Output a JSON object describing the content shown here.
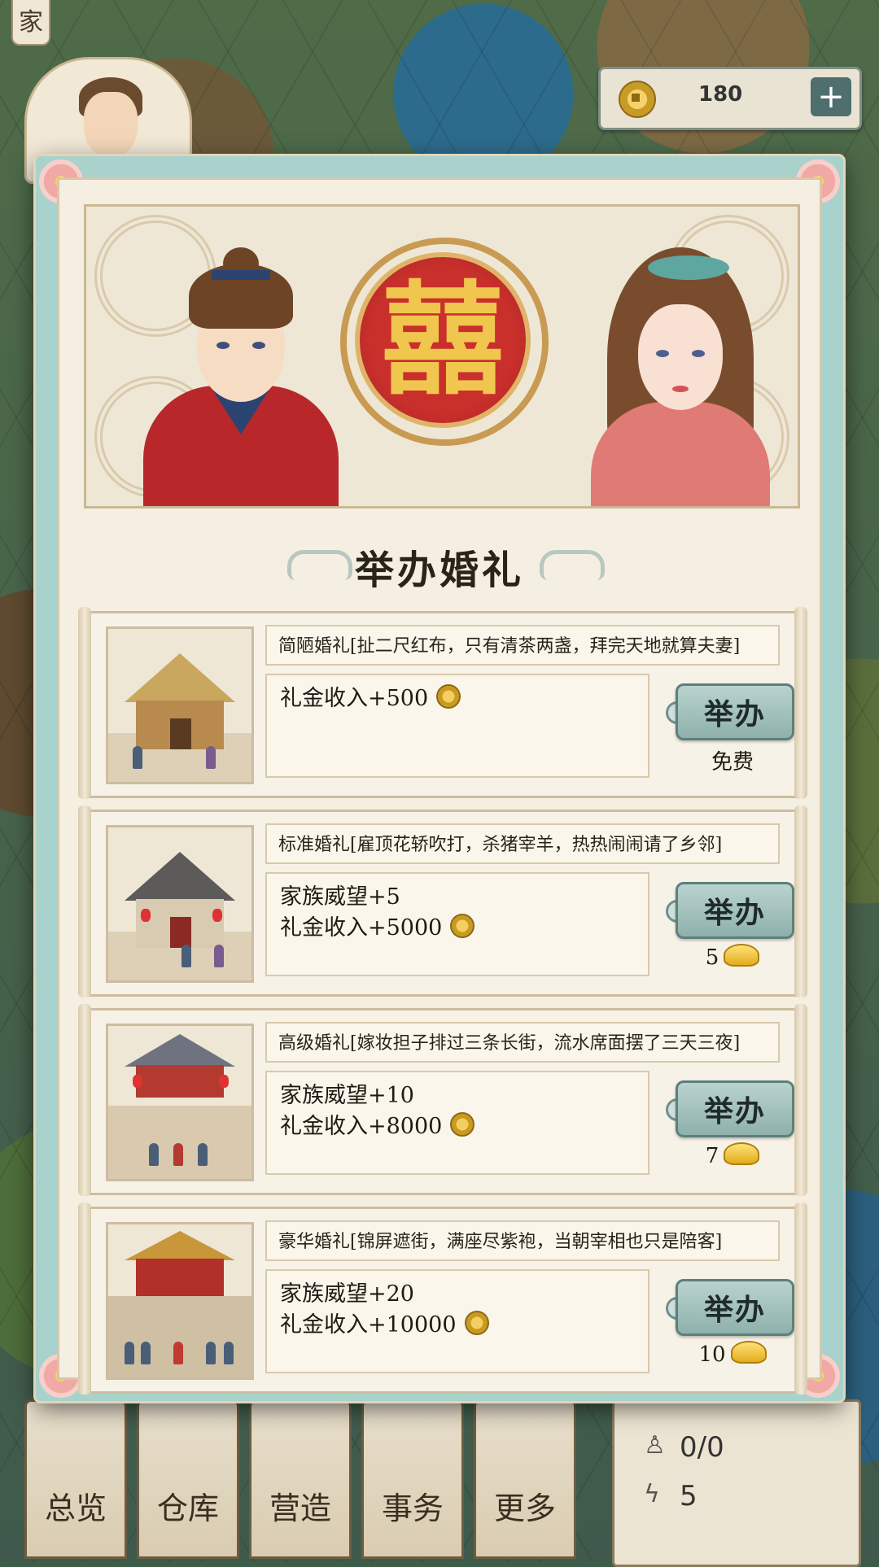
{
  "hud": {
    "top_badge": "家",
    "coin_amount": "180",
    "coin_add": "+"
  },
  "modal": {
    "title": "举办婚礼",
    "emblem_char": "囍"
  },
  "ceremonies": [
    {
      "description": "简陋婚礼[扯二尺红布，只有清茶两盏，拜完天地就算夫妻]",
      "reward_1": "礼金收入+500",
      "reward_2": "",
      "button": "举办",
      "cost": "免费"
    },
    {
      "description": "标准婚礼[雇顶花轿吹打，杀猪宰羊，热热闹闹请了乡邻]",
      "reward_1": "家族威望+5",
      "reward_2": "礼金收入+5000",
      "button": "举办",
      "cost": "5"
    },
    {
      "description": "高级婚礼[嫁妆担子排过三条长街，流水席面摆了三天三夜]",
      "reward_1": "家族威望+10",
      "reward_2": "礼金收入+8000",
      "button": "举办",
      "cost": "7"
    },
    {
      "description": "豪华婚礼[锦屏遮街，满座尽紫袍，当朝宰相也只是陪客]",
      "reward_1": "家族威望+20",
      "reward_2": "礼金收入+10000",
      "button": "举办",
      "cost": "10"
    }
  ],
  "bottom_nav": [
    {
      "label": "总览"
    },
    {
      "label": "仓库"
    },
    {
      "label": "营造"
    },
    {
      "label": "事务"
    },
    {
      "label": "更多"
    }
  ],
  "stats": {
    "workers": "0/0",
    "energy": "5"
  },
  "colors": {
    "modal_frame": "#a9d2cc",
    "emblem_red": "#c9302c",
    "button_teal": "#8fb1ab"
  }
}
